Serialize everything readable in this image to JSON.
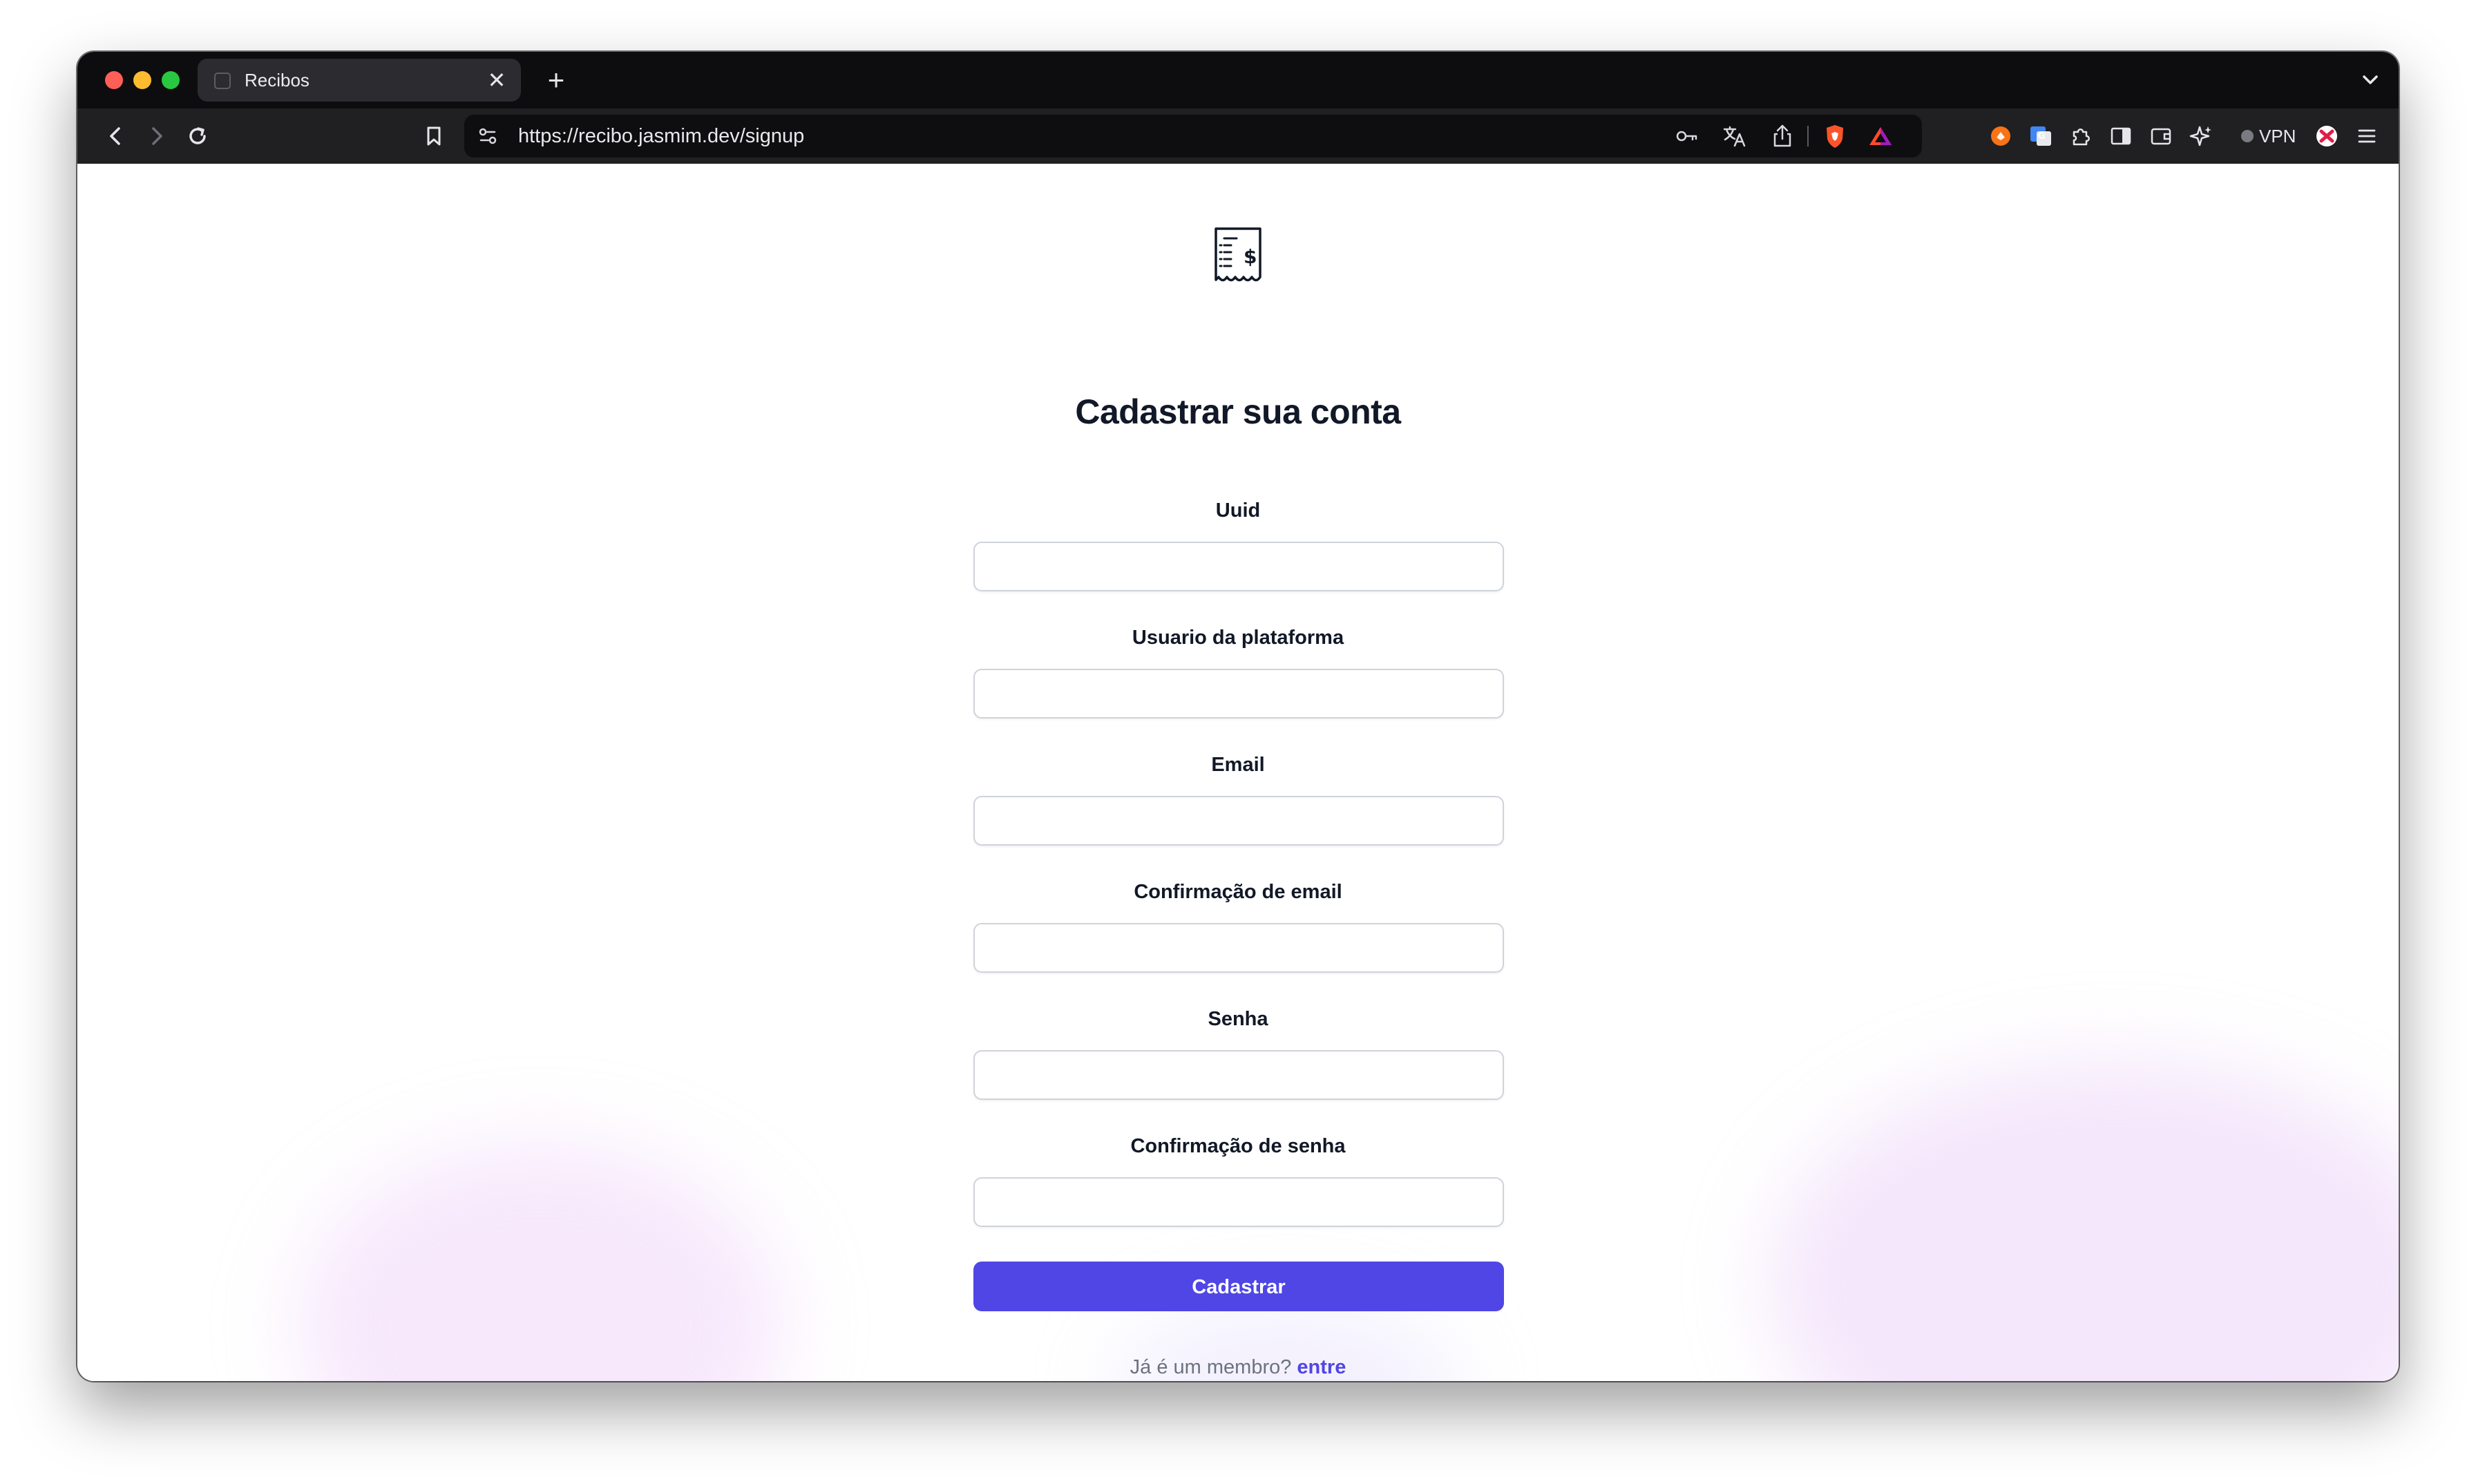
{
  "browser": {
    "tab": {
      "title": "Recibos",
      "close_glyph": "✕"
    },
    "new_tab_glyph": "+",
    "url": "https://recibo.jasmim.dev/signup",
    "vpn_label": "VPN"
  },
  "page": {
    "title": "Cadastrar sua conta",
    "fields": [
      {
        "label": "Uuid",
        "value": ""
      },
      {
        "label": "Usuario da plataforma",
        "value": ""
      },
      {
        "label": "Email",
        "value": ""
      },
      {
        "label": "Confirmação de email",
        "value": ""
      },
      {
        "label": "Senha",
        "value": ""
      },
      {
        "label": "Confirmação de senha",
        "value": ""
      }
    ],
    "submit_label": "Cadastrar",
    "member_prompt": "Já é um membro?",
    "login_link": "entre"
  },
  "colors": {
    "accent": "#4f46e5",
    "title": "#111827",
    "muted": "#6b7280",
    "chrome_dark": "#0d0d0f",
    "toolbar": "#202023"
  },
  "icons": [
    "back-arrow-icon",
    "forward-arrow-icon",
    "reload-icon",
    "bookmark-icon",
    "site-settings-icon",
    "key-icon",
    "translate-icon",
    "share-icon",
    "brave-shield-icon",
    "brave-rewards-icon",
    "wallet-extension-icon",
    "google-translate-extension-icon",
    "extensions-icon",
    "sidebar-icon",
    "wallet-icon",
    "leo-ai-icon",
    "vpn-icon",
    "profile-icon",
    "menu-icon",
    "receipt-logo-icon",
    "tab-list-icon"
  ]
}
